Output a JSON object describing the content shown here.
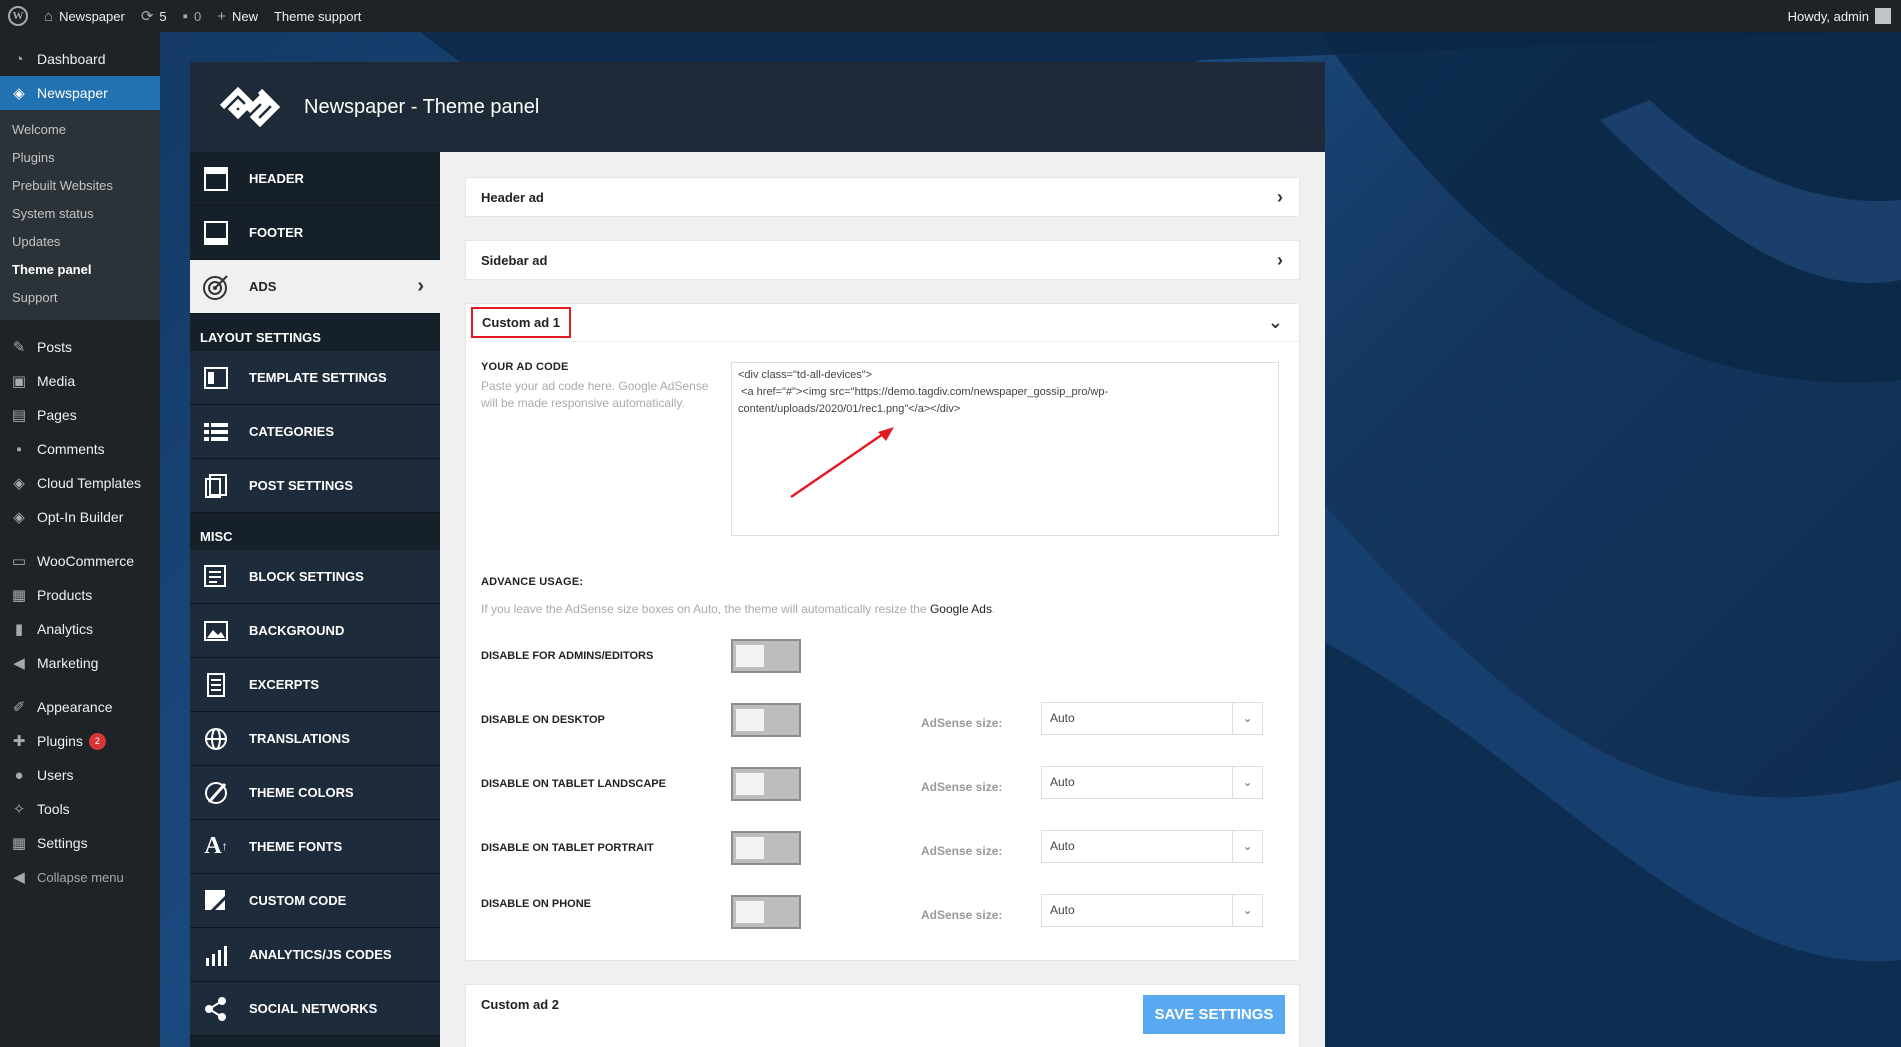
{
  "adminbar": {
    "site_name": "Newspaper",
    "updates_count": "5",
    "comments_count": "0",
    "new_label": "New",
    "theme_support": "Theme support",
    "howdy": "Howdy, admin"
  },
  "adminmenu": {
    "dashboard": "Dashboard",
    "newspaper": "Newspaper",
    "submenu": [
      "Welcome",
      "Plugins",
      "Prebuilt Websites",
      "System status",
      "Updates",
      "Theme panel",
      "Support"
    ],
    "items": [
      "Posts",
      "Media",
      "Pages",
      "Comments",
      "Cloud Templates",
      "Opt-In Builder"
    ],
    "items2": [
      "WooCommerce",
      "Products",
      "Analytics",
      "Marketing"
    ],
    "items3": [
      "Appearance",
      "Plugins",
      "Users",
      "Tools",
      "Settings"
    ],
    "plugins_badge": "2",
    "collapse": "Collapse menu"
  },
  "panel": {
    "title": "Newspaper - Theme panel",
    "nav_top": [
      "HEADER",
      "FOOTER",
      "ADS"
    ],
    "layout_section": "LAYOUT SETTINGS",
    "nav_layout": [
      "TEMPLATE SETTINGS",
      "CATEGORIES",
      "POST SETTINGS"
    ],
    "misc_section": "MISC",
    "nav_misc": [
      "BLOCK SETTINGS",
      "BACKGROUND",
      "EXCERPTS",
      "TRANSLATIONS",
      "THEME COLORS",
      "THEME FONTS",
      "CUSTOM CODE",
      "ANALYTICS/JS CODES",
      "SOCIAL NETWORKS"
    ]
  },
  "main": {
    "header_ad": "Header ad",
    "sidebar_ad": "Sidebar ad",
    "custom_ad_1": "Custom ad 1",
    "your_ad_code": "YOUR AD CODE",
    "ad_code_desc": "Paste your ad code here. Google AdSense will be made responsive automatically.",
    "ad_code_value": "<div class=\"td-all-devices\">\n <a href=\"#\"><img src=\"https://demo.tagdiv.com/newspaper_gossip_pro/wp-content/uploads/2020/01/rec1.png\"</a></div>",
    "advance_usage": "ADVANCE USAGE:",
    "advance_desc": "If you leave the AdSense size boxes on Auto, the theme will automatically resize the",
    "google_ads": "Google Ads",
    "period": ".",
    "disable_admins": "DISABLE FOR ADMINS/EDITORS",
    "disable_desktop": "DISABLE ON DESKTOP",
    "disable_tablet_landscape": "DISABLE ON TABLET LANDSCAPE",
    "disable_tablet_portrait": "DISABLE ON TABLET PORTRAIT",
    "disable_phone": "DISABLE ON PHONE",
    "adsense_size_label": "AdSense size:",
    "adsense_size_value": "Auto",
    "custom_ad_2": "Custom ad 2",
    "save_settings": "SAVE SETTINGS"
  }
}
